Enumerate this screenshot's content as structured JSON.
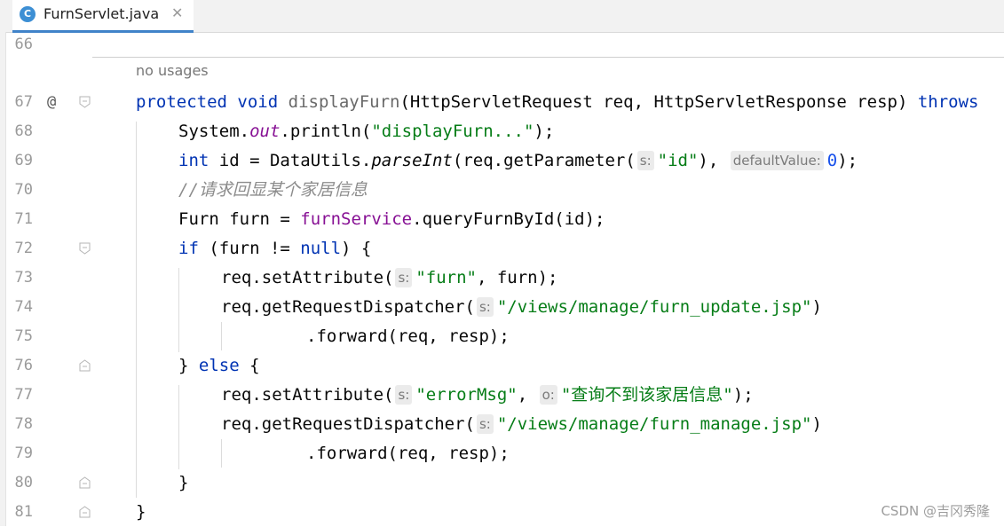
{
  "tab": {
    "icon_letter": "C",
    "label": "FurnServlet.java",
    "close": "✕"
  },
  "inlay": {
    "usages": "no usages"
  },
  "lines": {
    "l66": {
      "num": "66"
    },
    "l67": {
      "num": "67",
      "gutter": "@",
      "protected": "protected",
      "void": "void",
      "method": "displayFurn",
      "params": "(HttpServletRequest req, HttpServletResponse resp) ",
      "throws": "throws"
    },
    "l68": {
      "num": "68",
      "a": "System.",
      "out": "out",
      "b": ".println(",
      "str": "\"displayFurn...\"",
      "c": ");"
    },
    "l69": {
      "num": "69",
      "int": "int",
      "a": " id = DataUtils.",
      "parse": "parseInt",
      "b": "(req.getParameter(",
      "hint_s": "s:",
      "str": "\"id\"",
      "c": "), ",
      "hint_default": "defaultValue:",
      "zero": "0",
      "d": ");"
    },
    "l70": {
      "num": "70",
      "comment": "//请求回显某个家居信息"
    },
    "l71": {
      "num": "71",
      "a": "Furn furn = ",
      "service": "furnService",
      "b": ".queryFurnById(id);"
    },
    "l72": {
      "num": "72",
      "if": "if",
      "a": " (furn != ",
      "null": "null",
      "b": ") {"
    },
    "l73": {
      "num": "73",
      "a": "req.setAttribute(",
      "hint_s": "s:",
      "str": "\"furn\"",
      "b": ", furn);"
    },
    "l74": {
      "num": "74",
      "a": "req.getRequestDispatcher(",
      "hint_s": "s:",
      "str": "\"/views/manage/furn_update.jsp\"",
      "b": ")"
    },
    "l75": {
      "num": "75",
      "a": ".forward(req, resp);"
    },
    "l76": {
      "num": "76",
      "a": "} ",
      "else": "else",
      "b": " {"
    },
    "l77": {
      "num": "77",
      "a": "req.setAttribute(",
      "hint_s": "s:",
      "str1": "\"errorMsg\"",
      "b": ", ",
      "hint_o": "o:",
      "str2": "\"查询不到该家居信息\"",
      "c": ");"
    },
    "l78": {
      "num": "78",
      "a": "req.getRequestDispatcher(",
      "hint_s": "s:",
      "str": "\"/views/manage/furn_manage.jsp\"",
      "b": ")"
    },
    "l79": {
      "num": "79",
      "a": ".forward(req, resp);"
    },
    "l80": {
      "num": "80",
      "a": "}"
    },
    "l81": {
      "num": "81",
      "a": "}"
    }
  },
  "watermark": "CSDN @吉冈秀隆"
}
